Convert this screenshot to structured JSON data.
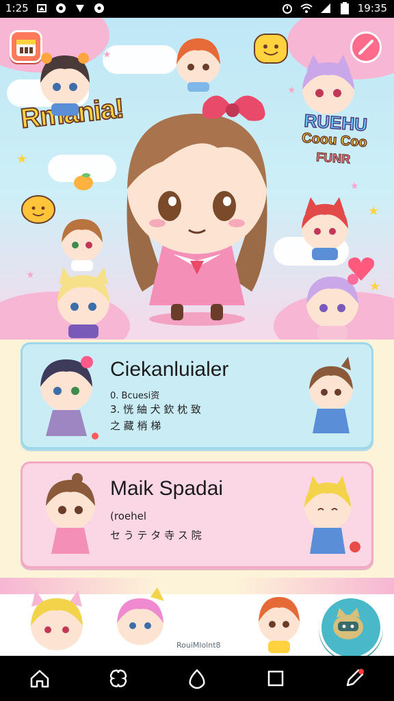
{
  "status_bar": {
    "time_left": "1:25",
    "time_right": "19:35",
    "icons_left": [
      "photo-icon",
      "circle-icon",
      "down-icon",
      "settings-icon"
    ],
    "icons_right": [
      "alarm-icon",
      "wifi-icon",
      "signal-icon",
      "battery-icon"
    ]
  },
  "hero": {
    "logo_left": "Rmania!",
    "logo_right_line1": "RUEHU",
    "logo_right_line2": "Coou Coo",
    "logo_right_line3": "FUNR"
  },
  "cards": [
    {
      "title": "Ciekanluialer",
      "line1": "0. Bcuesi资",
      "line2": "3. 恍 紬 犬 欽 枕 致",
      "line3": "之 藏 梢 梯"
    },
    {
      "title": "Maik Spadai",
      "line1": "(roehel",
      "line2": "セ う テ タ 寺 ス 院"
    }
  ],
  "bottom_strip": {
    "caption": "RouiMlolnt8"
  },
  "colors": {
    "card1_bg": "#c9ecf5",
    "card2_bg": "#fbd6e4",
    "accent_pink": "#ff6b8a",
    "fab": "#49b9c9"
  },
  "nav": {
    "items": [
      "home-icon",
      "puzzle-icon",
      "drop-icon",
      "square-icon",
      "pen-icon"
    ]
  }
}
